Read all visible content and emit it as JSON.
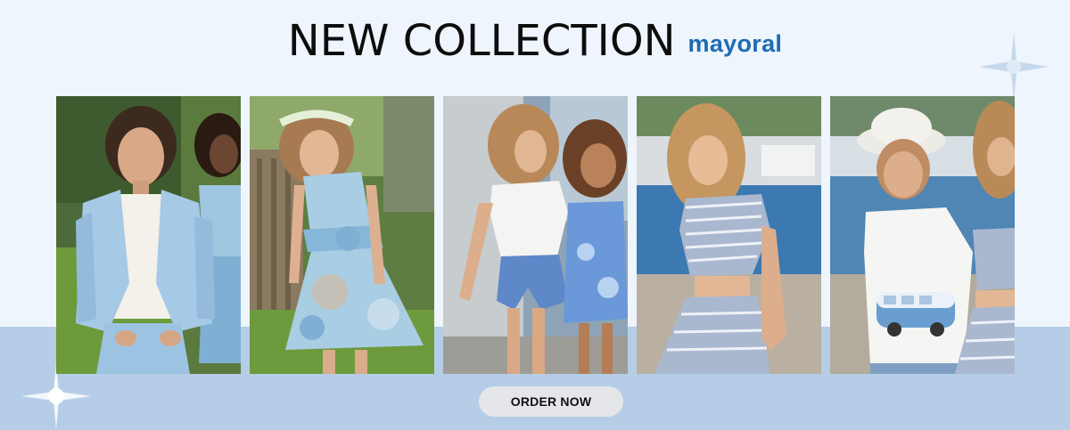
{
  "header": {
    "title": "NEW COLLECTION",
    "brand": "mayoral"
  },
  "photos": [
    {
      "name": "girl-blue-blazer-photo"
    },
    {
      "name": "girl-floral-dress-photo"
    },
    {
      "name": "girls-white-top-shorts-photo"
    },
    {
      "name": "girl-striped-set-photo"
    },
    {
      "name": "boy-bucket-hat-van-tee-photo"
    }
  ],
  "cta": {
    "label": "ORDER NOW"
  },
  "colors": {
    "background": "#eef5fc",
    "bottom_band": "#b5cde6",
    "brand": "#1f6bb5",
    "button": "#e4e6e9"
  }
}
